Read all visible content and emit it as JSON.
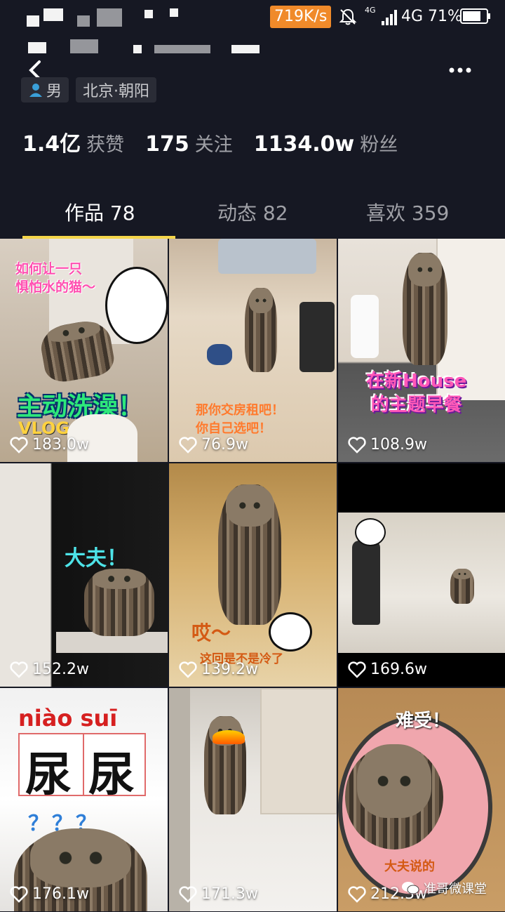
{
  "status_bar": {
    "net_speed": "719K/s",
    "net_small": "4G",
    "net_type": "4G",
    "battery": "71%"
  },
  "profile": {
    "gender": "男",
    "location": "北京·朝阳"
  },
  "stats": [
    {
      "num": "1.4亿",
      "label": "获赞"
    },
    {
      "num": "175",
      "label": "关注"
    },
    {
      "num": "1134.0w",
      "label": "粉丝"
    }
  ],
  "tabs": [
    {
      "label": "作品 78"
    },
    {
      "label": "动态 82"
    },
    {
      "label": "喜欢 359"
    }
  ],
  "videos": [
    {
      "likes": "183.0w",
      "caption_top": "如何让一只\n惧怕水的猫～",
      "caption_main": "主动洗澡！",
      "tag": "VLOG"
    },
    {
      "likes": "76.9w",
      "caption_bottom": "那你交房租吧！\n你自己选吧！"
    },
    {
      "likes": "108.9w",
      "caption_main": "在新House\n的主题早餐"
    },
    {
      "likes": "152.2w",
      "caption_main": "大夫！"
    },
    {
      "likes": "139.2w",
      "caption_main": "哎～",
      "caption_sub": "这回是不是冷了"
    },
    {
      "likes": "169.6w"
    },
    {
      "likes": "176.1w",
      "pinyin": "niào suī",
      "hanzi1": "尿",
      "hanzi2": "尿",
      "question": "？？？"
    },
    {
      "likes": "171.3w"
    },
    {
      "likes": "212.3w",
      "caption_main": "难受！",
      "caption_sub": "大夫说的"
    }
  ],
  "watermark": "准哥微课堂",
  "colors": {
    "background": "#161823",
    "tab_indicator": "#f5d64a",
    "net_speed_badge": "#f08a2a"
  }
}
